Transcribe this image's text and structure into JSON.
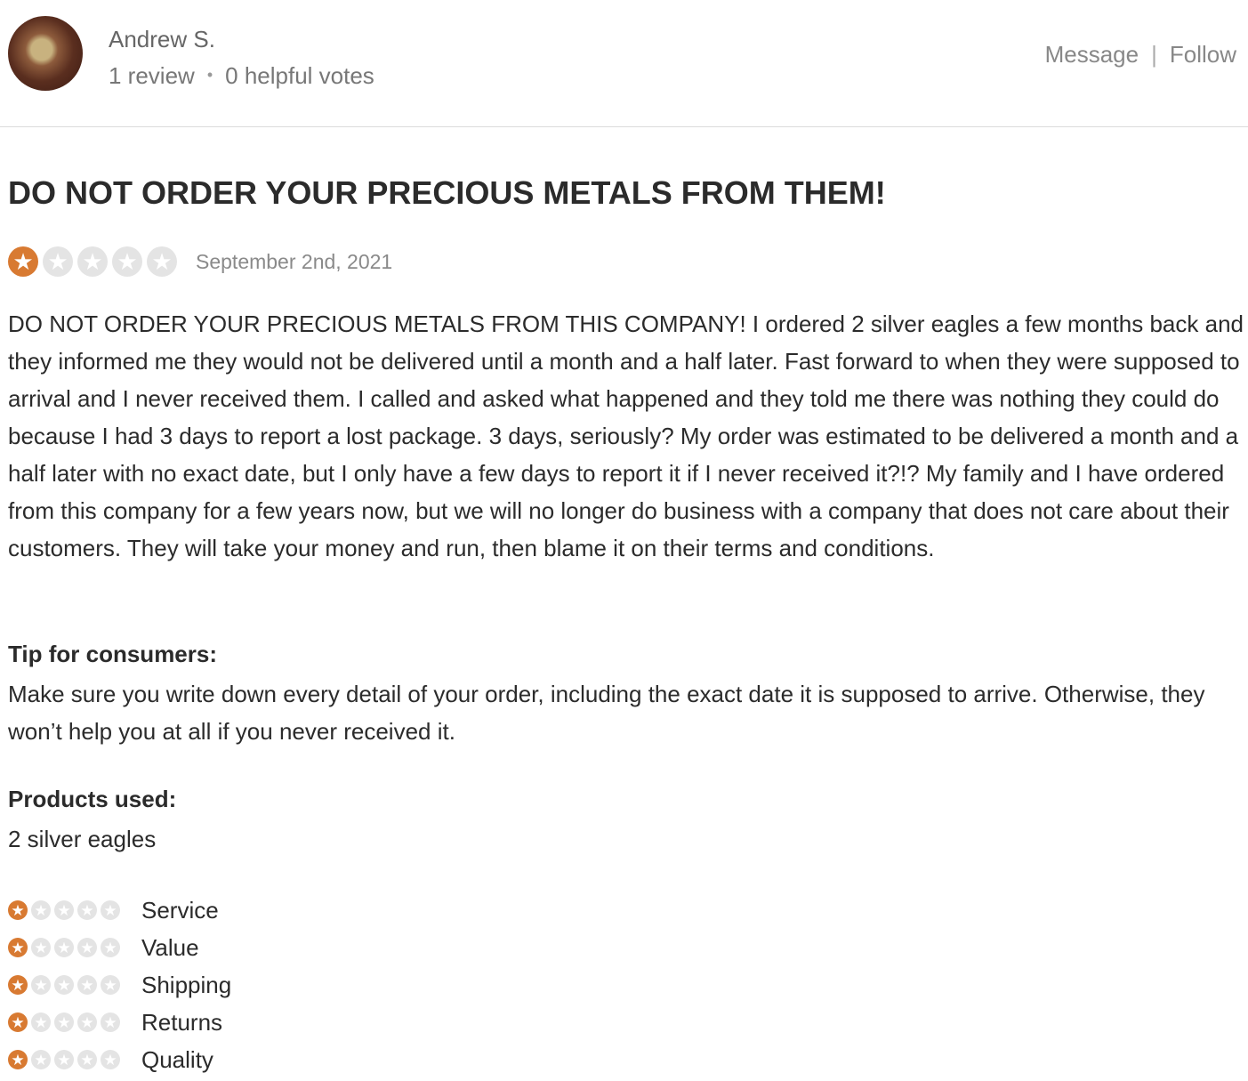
{
  "user": {
    "name": "Andrew S.",
    "review_count": "1 review",
    "separator": "•",
    "helpful_votes": "0 helpful votes"
  },
  "actions": {
    "message": "Message",
    "divider": "|",
    "follow": "Follow"
  },
  "review": {
    "title": "DO NOT ORDER YOUR PRECIOUS METALS FROM THEM!",
    "rating": 1,
    "rating_max": 5,
    "date": "September 2nd, 2021",
    "body": "DO NOT ORDER YOUR PRECIOUS METALS FROM THIS COMPANY! I ordered 2 silver eagles a few months back and they informed me they would not be delivered until a month and a half later. Fast forward to when they were supposed to arrival and I never received them. I called and asked what happened and they told me there was nothing they could do because I had 3 days to report a lost package. 3 days, seriously? My order was estimated to be delivered a month and a half later with no exact date, but I only have a few days to report it if I never received it?!? My family and I have ordered from this company for a few years now, but we will no longer do business with a company that does not care about their customers. They will take your money and run, then blame it on their terms and conditions.",
    "tip_label": "Tip for consumers:",
    "tip_text": "Make sure you write down every detail of your order, including the exact date it is supposed to arrive. Otherwise, they won’t help you at all if you never received it.",
    "products_label": "Products used:",
    "products_text": "2 silver eagles",
    "sub_ratings": [
      {
        "label": "Service",
        "rating": 1
      },
      {
        "label": "Value",
        "rating": 1
      },
      {
        "label": "Shipping",
        "rating": 1
      },
      {
        "label": "Returns",
        "rating": 1
      },
      {
        "label": "Quality",
        "rating": 1
      }
    ]
  },
  "colors": {
    "star_filled": "#d87a32",
    "star_empty": "#e4e4e4"
  },
  "icons": {
    "star": "star-icon",
    "avatar": "user-avatar-photo"
  }
}
